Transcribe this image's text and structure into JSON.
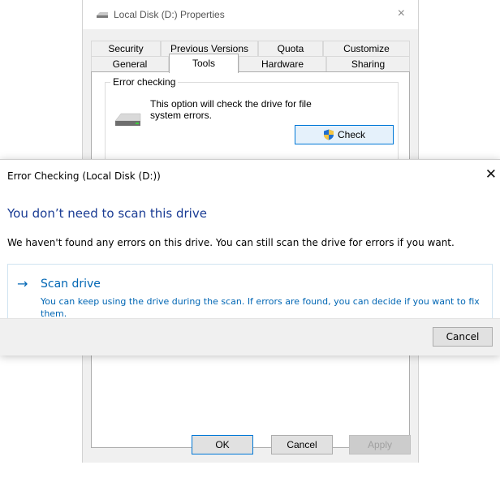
{
  "properties_window": {
    "title": "Local Disk (D:) Properties",
    "close_glyph": "×",
    "tabs_row1": [
      "Security",
      "Previous Versions",
      "Quota",
      "Customize"
    ],
    "tabs_row2": [
      "General",
      "Tools",
      "Hardware",
      "Sharing"
    ],
    "active_tab": "Tools",
    "error_checking": {
      "legend": "Error checking",
      "description": "This option will check the drive for file system errors.",
      "check_button": "Check",
      "drive_icon": "drive-icon",
      "shield_icon": "uac-shield-icon"
    },
    "buttons": {
      "ok": "OK",
      "cancel": "Cancel",
      "apply": "Apply"
    }
  },
  "error_dialog": {
    "title": "Error Checking (Local Disk (D:))",
    "close_glyph": "✕",
    "heading": "You don’t need to scan this drive",
    "message": "We haven't found any errors on this drive. You can still scan the drive for errors if you want.",
    "scan_option": {
      "arrow_glyph": "→",
      "title": "Scan drive",
      "description": "You can keep using the drive during the scan. If errors are found, you can decide if you want to fix them."
    },
    "cancel_button": "Cancel"
  },
  "colors": {
    "heading_blue": "#1a3c94",
    "link_blue": "#0066b4",
    "accent_blue": "#0078d7"
  }
}
